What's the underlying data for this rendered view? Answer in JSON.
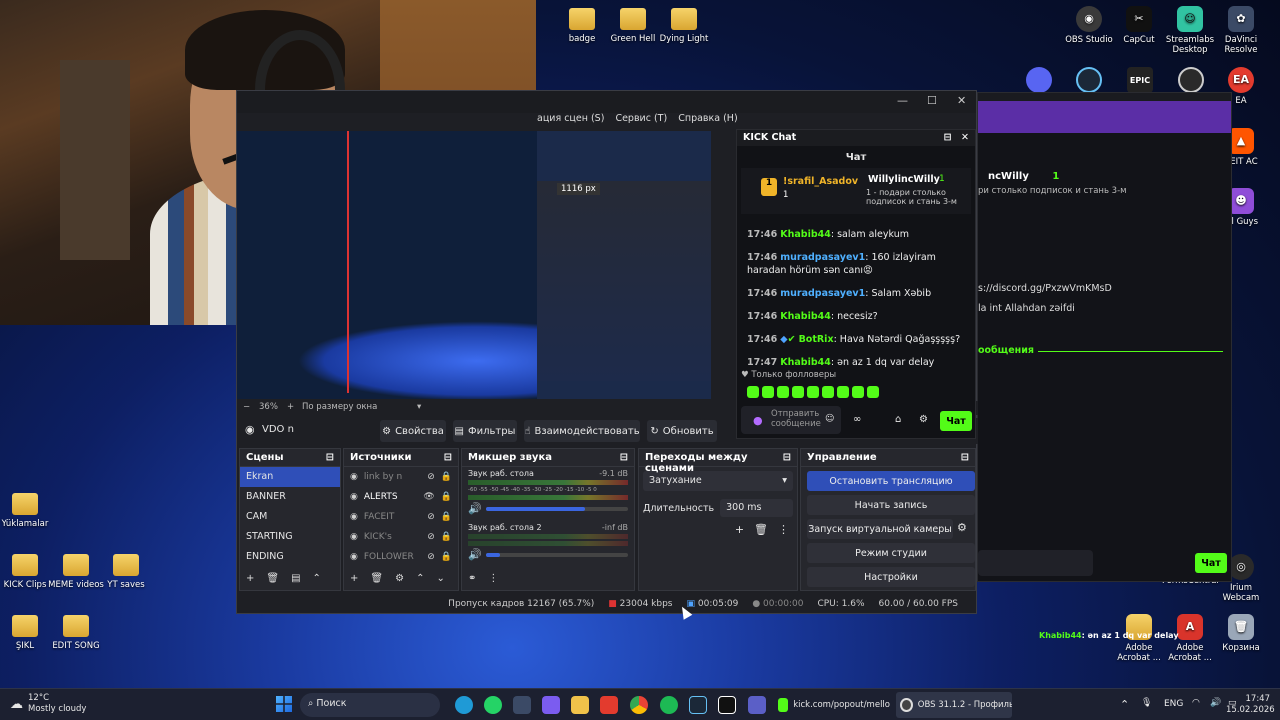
{
  "desktop": {
    "top_icons": [
      {
        "label": "badge"
      },
      {
        "label": "Green Hell"
      },
      {
        "label": "Dying Light"
      }
    ],
    "left_icons": [
      {
        "label": "Yüklamalar"
      },
      {
        "label": "KICK Clips"
      },
      {
        "label": "MEME videos"
      },
      {
        "label": "YT saves"
      },
      {
        "label": "ŞIKL"
      },
      {
        "label": "EDIT SONG"
      }
    ],
    "right_icons": [
      {
        "label": "OBS Studio",
        "icon": "obs-icon",
        "color": "#3a3a3a"
      },
      {
        "label": "CapCut",
        "icon": "capcut-icon",
        "color": "#111111"
      },
      {
        "label": "Streamlabs Desktop",
        "icon": "streamlabs-icon",
        "color": "#31c3a2"
      },
      {
        "label": "DaVinci Resolve",
        "icon": "davinci-icon",
        "color": "#3b4a66"
      },
      {
        "label": "EA",
        "icon": "ea-icon",
        "color": "#e33b2e"
      },
      {
        "label": "CEIT AC",
        "icon": "faceit-icon",
        "color": "#ff5500"
      },
      {
        "label": "all Guys",
        "icon": "fallguys-icon",
        "color": "#8f4dd8"
      },
      {
        "label": "Irium Webcam",
        "icon": "webcam-icon",
        "color": "#2a2a2a"
      },
      {
        "label": "Adobe Acrobat ...",
        "icon": "folder-icon",
        "color": "#f0c24a"
      },
      {
        "label": "Adobe Acrobat ...",
        "icon": "acrobat-icon",
        "color": "#d9342b"
      },
      {
        "label": "Корзина",
        "icon": "recycle-bin-icon",
        "color": "#9aa7b8"
      },
      {
        "label": "FormsCentral"
      }
    ]
  },
  "obs": {
    "menu": [
      "ация сцен (S)",
      "Сервис (T)",
      "Справка (H)"
    ],
    "preview_label": "1116 px",
    "zoom": "36%",
    "zoom_mode": "По размеру окна",
    "selected_source": "VDO n",
    "toolbar": {
      "properties": "Свойства",
      "filters": "Фильтры",
      "interact": "Взаимодействовать",
      "refresh": "Обновить"
    },
    "scenes": {
      "title": "Сцены",
      "items": [
        "Ekran",
        "BANNER",
        "CAM",
        "STARTING",
        "ENDING"
      ]
    },
    "sources": {
      "title": "Источники",
      "items": [
        "link by n",
        "ALERTS",
        "FACEIT",
        "KICK's",
        "FOLLOWER"
      ]
    },
    "mixer": {
      "title": "Микшер звука",
      "channels": [
        {
          "name": "Звук раб. стола",
          "level": "-9.1 dB",
          "volume": 0.7
        },
        {
          "name": "Звук раб. стола 2",
          "level": "-inf dB",
          "volume": 0.1
        }
      ],
      "scale": "-60 -55 -50 -45 -40 -35 -30 -25 -20 -15 -10 -5 0"
    },
    "transitions": {
      "title": "Переходы между сценами",
      "type": "Затухание",
      "duration_label": "Длительность",
      "duration": "300 ms"
    },
    "controls": {
      "title": "Управление",
      "stop_stream": "Остановить трансляцию",
      "record": "Начать запись",
      "virtual_cam": "Запуск виртуальной камеры",
      "studio": "Режим студии",
      "settings": "Настройки"
    },
    "status": {
      "dropped": "Пропуск кадров 12167 (65.7%)",
      "bitrate": "23004 kbps",
      "stream_time": "00:05:09",
      "rec_time": "00:00:00",
      "cpu": "CPU: 1.6%",
      "fps": "60.00 / 60.00 FPS"
    }
  },
  "kick_chat": {
    "window_title": "KICK Chat",
    "header": "Чат",
    "pinned_user": "!srafil_Asadov",
    "pinned_rank": "1",
    "gift_user": "WillylincWilly",
    "gift_count": "1",
    "gift_text": "1 - подари столько подписок и стань 3-м",
    "messages": [
      {
        "time": "17:46",
        "user": "Khabib44",
        "text": ": salam aleykum",
        "color": "green"
      },
      {
        "time": "17:46",
        "user": "muradpasayev1",
        "text": ": 160 izlayiram haradan hörüm sən canı😡",
        "color": "blue"
      },
      {
        "time": "17:46",
        "user": "muradpasayev1",
        "text": ": Salam Xəbib",
        "color": "blue"
      },
      {
        "time": "17:46",
        "user": "Khabib44",
        "text": ": necesiz?",
        "color": "green"
      },
      {
        "time": "17:46",
        "user": "BotRix",
        "text": ": Hava Nətərdi Qağaşşşşş?",
        "color": "green"
      },
      {
        "time": "17:47",
        "user": "Khabib44",
        "text": ": ən az 1 dq var delay",
        "color": "green"
      }
    ],
    "followers_only": "Только фолловеры",
    "input_placeholder": "Отправить сообщение",
    "send": "Чат"
  },
  "browser": {
    "user": "ncWilly",
    "count": "1",
    "gift_text": "ри столько подписок и стань 3-м",
    "link": "s://discord.gg/PxzwVmKMsD",
    "line2": "la int Allahdan zəifdi",
    "section": "ообщения",
    "send": "Чат",
    "overlay_msg_user": "Khabib44",
    "overlay_msg_text": ": ən az 1 dq var delay"
  },
  "taskbar": {
    "weather_temp": "12°C",
    "weather_desc": "Mostly cloudy",
    "search": "Поиск",
    "kick_tab": "kick.com/popout/mello",
    "obs_tab": "OBS 31.1.2 - Профиль: Б",
    "lang": "ENG",
    "time": "17:47",
    "date": "15.02.2026"
  }
}
